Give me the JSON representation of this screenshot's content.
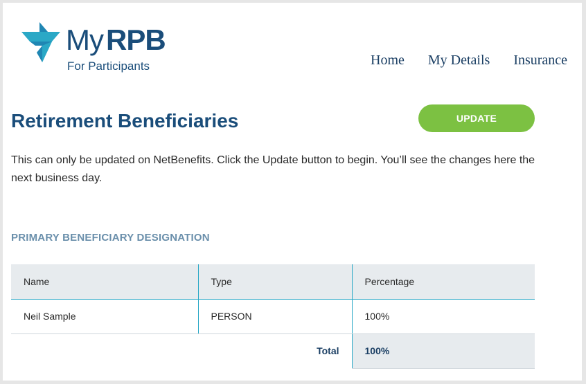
{
  "brand": {
    "logo_my": "My",
    "logo_rpb": "RPB",
    "logo_subtitle": "For Participants",
    "primary_color": "#1a4d7a",
    "accent_color": "#2aa8c6"
  },
  "nav": {
    "items": [
      {
        "label": "Home"
      },
      {
        "label": "My Details"
      },
      {
        "label": "Insurance"
      }
    ]
  },
  "page": {
    "title": "Retirement Beneficiaries",
    "update_button": "UPDATE",
    "update_button_color": "#7cc142",
    "intro": "This can only be updated on NetBenefits. Click the Update button to begin. You’ll see the changes here the next business day."
  },
  "section": {
    "heading": "PRIMARY BENEFICIARY DESIGNATION"
  },
  "table": {
    "headers": [
      "Name",
      "Type",
      "Percentage"
    ],
    "rows": [
      [
        "Neil Sample",
        "PERSON",
        "100%"
      ]
    ],
    "total_label": "Total",
    "total_value": "100%"
  }
}
